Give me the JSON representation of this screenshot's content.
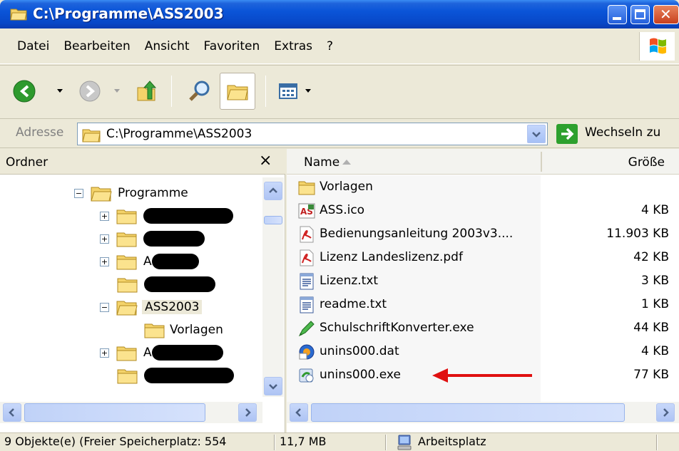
{
  "window": {
    "title": "C:\\Programme\\ASS2003"
  },
  "menu": {
    "items": [
      "Datei",
      "Bearbeiten",
      "Ansicht",
      "Favoriten",
      "Extras",
      "?"
    ]
  },
  "address": {
    "label": "Adresse",
    "value": "C:\\Programme\\ASS2003",
    "go_label": "Wechseln zu"
  },
  "folders": {
    "header": "Ordner",
    "close_label": "×",
    "tree": [
      {
        "label": "Programme",
        "expander": "−"
      },
      {
        "label": "",
        "expander": "+"
      },
      {
        "label": "",
        "expander": "+"
      },
      {
        "label": "A",
        "expander": "+"
      },
      {
        "label": "",
        "expander": ""
      },
      {
        "label": "ASS2003",
        "expander": "−"
      },
      {
        "label": "Vorlagen",
        "expander": ""
      },
      {
        "label": "A",
        "expander": "+"
      },
      {
        "label": "",
        "expander": ""
      }
    ]
  },
  "files": {
    "columns": {
      "name": "Name",
      "size": "Größe"
    },
    "rows": [
      {
        "name": "Vorlagen",
        "size": "",
        "icon": "folder-icon"
      },
      {
        "name": "ASS.ico",
        "size": "4 KB",
        "icon": "ico-file-icon"
      },
      {
        "name": "Bedienungsanleitung 2003v3....",
        "size": "11.903 KB",
        "icon": "pdf-icon"
      },
      {
        "name": "Lizenz Landeslizenz.pdf",
        "size": "42 KB",
        "icon": "pdf-icon"
      },
      {
        "name": "Lizenz.txt",
        "size": "3 KB",
        "icon": "text-file-icon"
      },
      {
        "name": "readme.txt",
        "size": "1 KB",
        "icon": "text-file-icon"
      },
      {
        "name": "SchulschriftKonverter.exe",
        "size": "44 KB",
        "icon": "exe-pen-icon"
      },
      {
        "name": "unins000.dat",
        "size": "4 KB",
        "icon": "dat-file-icon"
      },
      {
        "name": "unins000.exe",
        "size": "77 KB",
        "icon": "exe-uninstall-icon"
      }
    ]
  },
  "status": {
    "objects": "9 Objekte(e) (Freier Speicherplatz: 554",
    "size": "11,7 MB",
    "location": "Arbeitsplatz"
  },
  "colors": {
    "title_bar": "#0A54D8",
    "annotation_arrow": "#E01010",
    "go_button": "#2DA02D"
  }
}
